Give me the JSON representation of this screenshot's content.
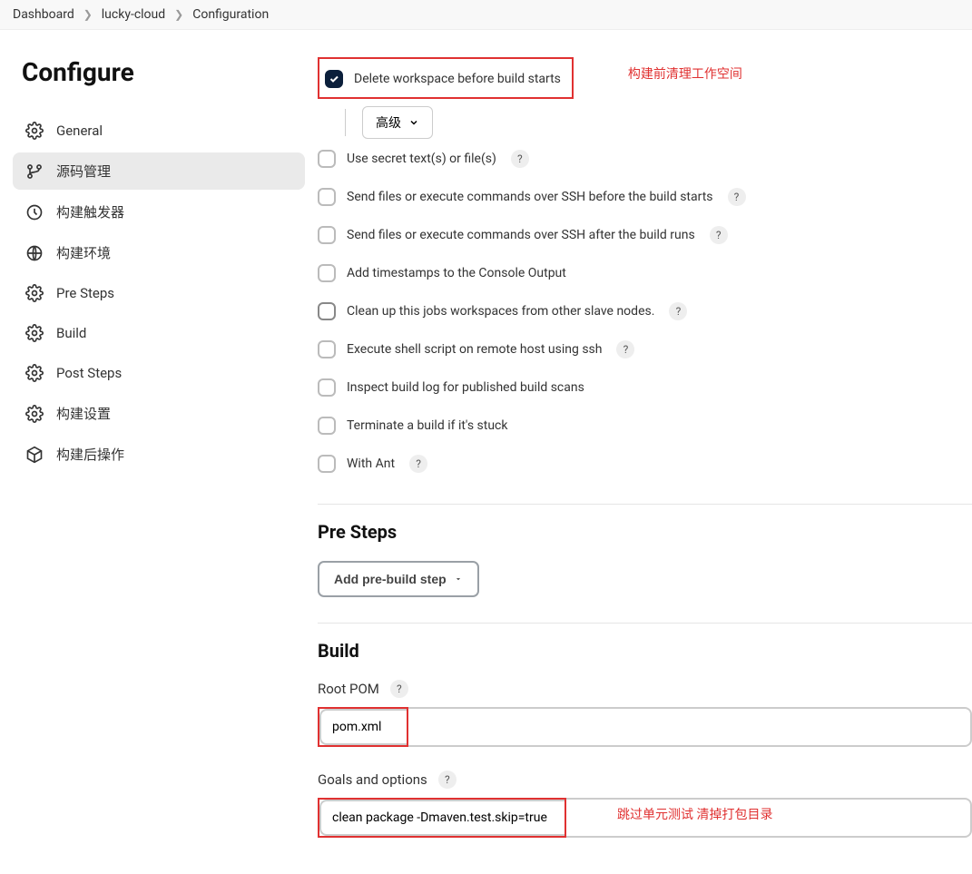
{
  "breadcrumb": {
    "items": [
      "Dashboard",
      "lucky-cloud",
      "Configuration"
    ]
  },
  "sidebar": {
    "title": "Configure",
    "items": [
      {
        "label": "General"
      },
      {
        "label": "源码管理"
      },
      {
        "label": "构建触发器"
      },
      {
        "label": "构建环境"
      },
      {
        "label": "Pre Steps"
      },
      {
        "label": "Build"
      },
      {
        "label": "Post Steps"
      },
      {
        "label": "构建设置"
      },
      {
        "label": "构建后操作"
      }
    ]
  },
  "env": {
    "delete_workspace": "Delete workspace before build starts",
    "advanced": "高级",
    "use_secret": "Use secret text(s) or file(s)",
    "ssh_before": "Send files or execute commands over SSH before the build starts",
    "ssh_after": "Send files or execute commands over SSH after the build runs",
    "timestamps": "Add timestamps to the Console Output",
    "cleanup": "Clean up this jobs workspaces from other slave nodes.",
    "exec_shell": "Execute shell script on remote host using ssh",
    "inspect_log": "Inspect build log for published build scans",
    "terminate": "Terminate a build if it's stuck",
    "with_ant": "With Ant"
  },
  "annotations": {
    "clean_workspace": "构建前清理工作空间",
    "goals": "跳过单元测试 清掉打包目录"
  },
  "presteps": {
    "title": "Pre Steps",
    "add_button": "Add pre-build step"
  },
  "build": {
    "title": "Build",
    "root_pom_label": "Root POM",
    "root_pom_value": "pom.xml",
    "goals_label": "Goals and options",
    "goals_value": "clean package -Dmaven.test.skip=true"
  },
  "help": "?"
}
